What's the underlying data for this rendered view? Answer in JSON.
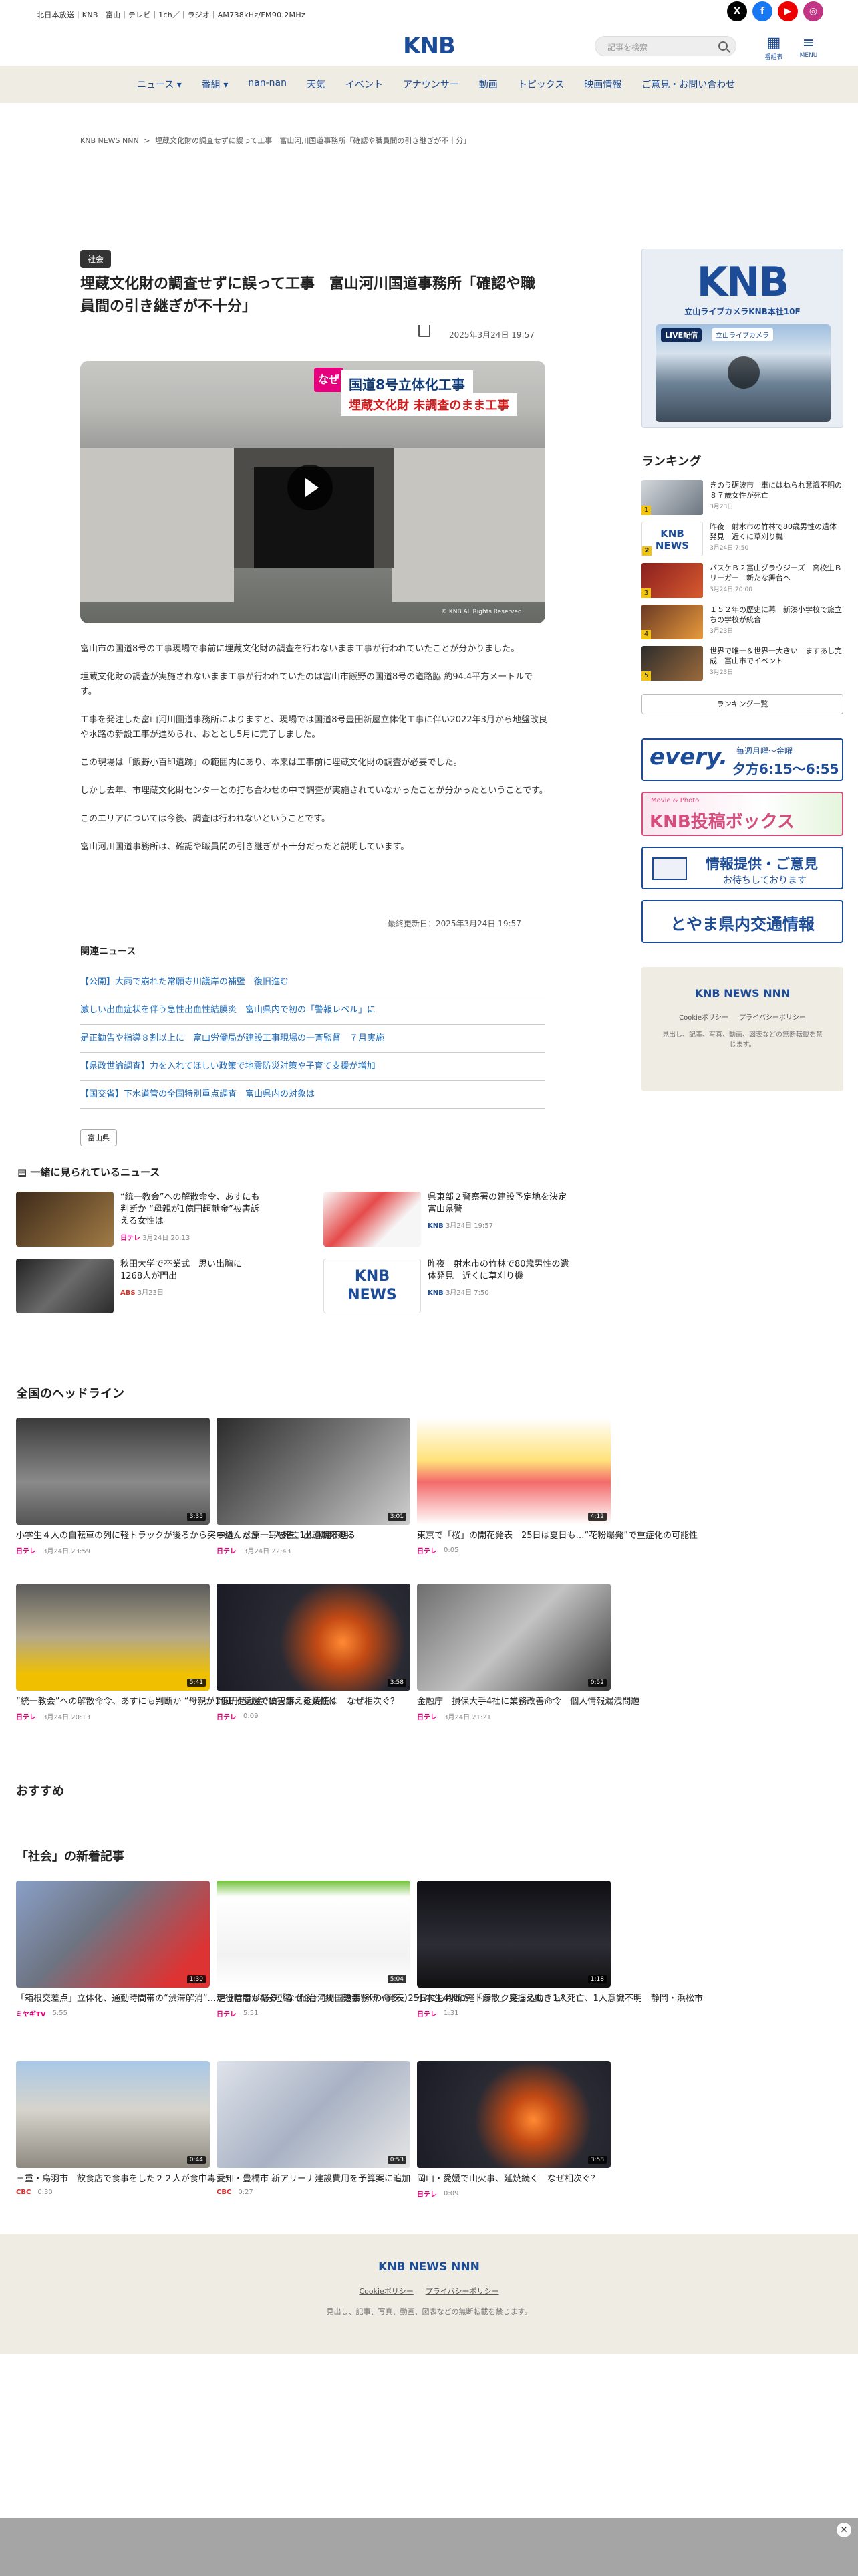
{
  "topbar": {
    "channels": "北日本放送｜KNB｜富山｜テレビ｜1ch／｜ラジオ｜AM738kHz/FM90.2MHz",
    "search_placeholder": "記事を検索",
    "bangumi_label": "番組表",
    "menu_label": "MENU",
    "logo": "KNB"
  },
  "nav": {
    "items": [
      "ニュース ▾",
      "番組 ▾",
      "nan-nan",
      "天気",
      "イベント",
      "アナウンサー",
      "動画",
      "トピックス",
      "映画情報",
      "ご意見・お問い合わせ"
    ]
  },
  "breadcrumb": {
    "home": "KNB NEWS NNN",
    "sep": ">",
    "current": "埋蔵文化財の調査せずに誤って工事　富山河川国道事務所「確認や職員間の引き継ぎが不十分」"
  },
  "article": {
    "category": "社会",
    "title": "埋蔵文化財の調査せずに誤って工事　富山河川国道事務所「確認や職員間の引き継ぎが不十分」",
    "date": "2025年3月24日 19:57",
    "video": {
      "tag": "なぜ",
      "caption1": "国道8号立体化工事",
      "caption2": "埋蔵文化財 未調査のまま工事",
      "copyright": "© KNB All Rights Reserved"
    },
    "paragraphs": [
      "富山市の国道8号の工事現場で事前に埋蔵文化財の調査を行わないまま工事が行われていたことが分かりました。",
      "埋蔵文化財の調査が実施されないまま工事が行われていたのは富山市飯野の国道8号の道路脇 約94.4平方メートルです。",
      "工事を発注した富山河川国道事務所によりますと、現場では国道8号豊田新屋立体化工事に伴い2022年3月から地盤改良や水路の新設工事が進められ、おととし5月に完了しました。",
      "この現場は「飯野小百印遺跡」の範囲内にあり、本来は工事前に埋蔵文化財の調査が必要でした。",
      "しかし去年、市埋蔵文化財センターとの打ち合わせの中で調査が実施されていなかったことが分かったということです。",
      "このエリアについては今後、調査は行われないということです。",
      "富山河川国道事務所は、確認や職員間の引き継ぎが不十分だったと説明しています。"
    ],
    "updated": "最終更新日：2025年3月24日 19:57",
    "tag": "富山県"
  },
  "related": {
    "heading": "関連ニュース",
    "items": [
      "【公開】大雨で崩れた常願寺川護岸の補壁　復旧進む",
      "激しい出血症状を伴う急性出血性結膜炎　富山県内で初の「警報レベル」に",
      "是正勧告や指導８割以上に　富山労働局が建設工事現場の一斉監督　７月実施",
      "【県政世論調査】力を入れてほしい政策で地震防災対策や子育て支援が増加",
      "【国交省】下水道管の全国特別重点調査　富山県内の対象は"
    ]
  },
  "watched": {
    "heading": "一緒に見られているニュース",
    "items": [
      {
        "title": "“統一教会”への解散命令、あすにも判断か “母親が1億円超献金”被害訴える女性は",
        "brand": "日テレ",
        "date": "3月24日 20:13"
      },
      {
        "title": "県東部２警察署の建設予定地を決定　富山県警",
        "brand": "KNB",
        "date": "3月24日 19:57"
      },
      {
        "title": "秋田大学で卒業式　思い出胸に1268人が門出",
        "brand": "ABS",
        "date": "3月23日"
      },
      {
        "title": "昨夜　射水市の竹林で80歳男性の遺体発見　近くに草刈り機",
        "brand": "KNB",
        "date": "3月24日 7:50"
      }
    ]
  },
  "national": {
    "heading": "全国のヘッドライン",
    "items": [
      {
        "title": "小学生４人の自転車の列に軽トラックが後ろから突っ込んだか　1人死亡1人意識不明",
        "brand": "日テレ",
        "date": "3月24日 23:59",
        "dur": "3:35"
      },
      {
        "title": "中継：水原一平被告、出頭期限迫る",
        "brand": "日テレ",
        "date": "3月24日 22:43",
        "dur": "3:01"
      },
      {
        "title": "東京で「桜」の開花発表　25日は夏日も…“花粉爆発”で重症化の可能性",
        "brand": "日テレ",
        "date": "0:05",
        "dur": "4:12"
      },
      {
        "title": "“統一教会”への解散命令、あすにも判断か “母親が1億円超献金”被害訴える女性は",
        "brand": "日テレ",
        "date": "3月24日 20:13",
        "dur": "5:41"
      },
      {
        "title": "岡山・愛媛で山火事、延焼続く　なぜ相次ぐ？",
        "brand": "日テレ",
        "date": "0:09",
        "dur": "3:58"
      },
      {
        "title": "金融庁　損保大手4社に業務改善命令　個人情報漏洩問題",
        "brand": "日テレ",
        "date": "3月24日 21:21",
        "dur": "0:52"
      }
    ]
  },
  "recommend": {
    "heading": "おすすめ"
  },
  "shakai": {
    "heading": "「社会」の新着記事",
    "items": [
      {
        "title": "「箱根交差点」立体化、通勤時間帯の“渋滞解消”…走行時間も4分短縮（仙台河川国道事務所・発表）",
        "brand": "ミヤギTV",
        "date": "5:55",
        "dur": "1:30"
      },
      {
        "title": "現役信者が語る「なぜ今」“統一教会”への命令、25日にも判断か 「解散」見据え動きも？",
        "brand": "日テレ",
        "date": "5:51",
        "dur": "5:04"
      },
      {
        "title": "小学生4人に軽トラック突っ込む　1人死亡、1人意識不明　静岡・浜松市",
        "brand": "日テレ",
        "date": "1:31",
        "dur": "1:18"
      },
      {
        "title": "三重・鳥羽市　飲食店で食事をした２２人が食中毒",
        "brand": "CBC",
        "date": "0:30",
        "dur": "0:44"
      },
      {
        "title": "愛知・豊橋市 新アリーナ建設費用を予算案に追加",
        "brand": "CBC",
        "date": "0:27",
        "dur": "0:53"
      },
      {
        "title": "岡山・愛媛で山火事、延焼続く　なぜ相次ぐ？",
        "brand": "日テレ",
        "date": "0:09",
        "dur": "3:58"
      }
    ]
  },
  "sidebar": {
    "live_banner": {
      "logo": "KNB",
      "sub": "立山ライブカメラKNB本社10F",
      "live": "LIVE配信",
      "cam": "立山ライブカメラ"
    },
    "ranking_heading": "ランキング",
    "ranking": [
      {
        "title": "きのう砺波市　車にはねられ意識不明の８７歳女性が死亡",
        "date": "3月23日"
      },
      {
        "title": "昨夜　射水市の竹林で80歳男性の遺体発見　近くに草刈り機",
        "date": "3月24日 7:50"
      },
      {
        "title": "バスケＢ２富山グラウジーズ　高校生Ｂリーガー　新たな舞台へ",
        "date": "3月24日 20:00"
      },
      {
        "title": "１５２年の歴史に幕　新湊小学校で旅立ちの学校が統合",
        "date": "3月23日"
      },
      {
        "title": "世界で唯一＆世界一大きい　ますあし完成　富山市でイベント",
        "date": "3月23日"
      }
    ],
    "ranking_more": "ランキング一覧",
    "every": {
      "brand": "every.",
      "sub": "毎週月曜〜金曜",
      "time": "夕方6:15〜6:55"
    },
    "toko": {
      "title": "KNB投稿ボックス",
      "sub": "Movie & Photo"
    },
    "info": {
      "title": "情報提供・ご意見",
      "sub": "お待ちしております"
    },
    "traffic": "とやま県内交通情報",
    "newsnnn": "KNB NEWS NNN",
    "cookie": "Cookieポリシー",
    "privacy": "プライバシーポリシー",
    "note": "見出し、記事、写真、動画、図表などの無断転載を禁じます。"
  },
  "footer": {
    "logo": "KNB NEWS NNN",
    "cookie": "Cookieポリシー",
    "privacy": "プライバシーポリシー",
    "note": "見出し、記事、写真、動画、図表などの無断転載を禁じます。"
  }
}
